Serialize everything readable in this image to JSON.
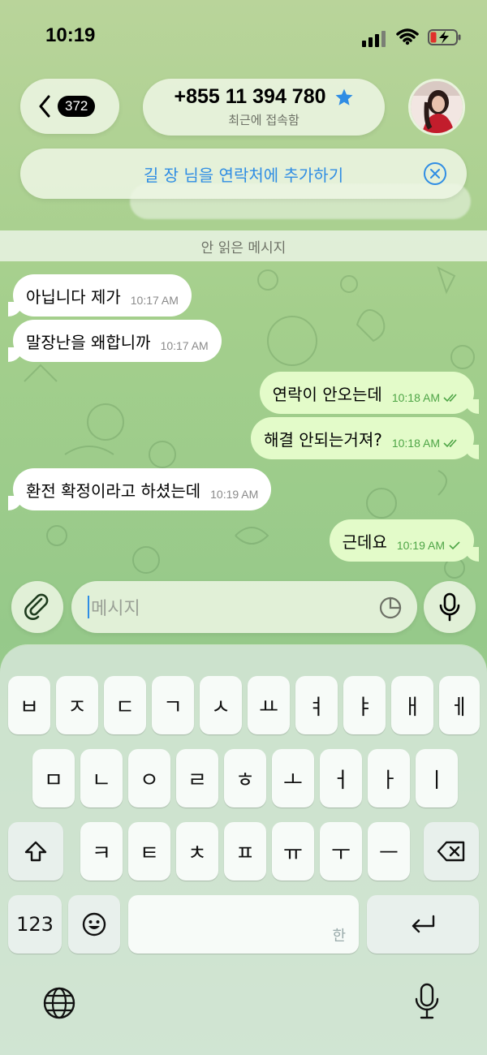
{
  "status_bar": {
    "time": "10:19"
  },
  "header": {
    "unread_count": "372",
    "phone": "+855 11 394 780",
    "subtitle": "최근에 접속함"
  },
  "banner": {
    "text": "길 장 님을 연락처에 추가하기"
  },
  "unread_divider": "안 읽은 메시지",
  "messages": [
    {
      "dir": "in",
      "text": "아닙니다 제가",
      "time": "10:17 AM"
    },
    {
      "dir": "in",
      "text": "말장난을 왜합니까",
      "time": "10:17 AM"
    },
    {
      "dir": "out",
      "text": "연락이 안오는데",
      "time": "10:18 AM",
      "status": "read"
    },
    {
      "dir": "out",
      "text": "해결 안되는거져?",
      "time": "10:18 AM",
      "status": "read"
    },
    {
      "dir": "in",
      "text": "환전 확정이라고 하셨는데",
      "time": "10:19 AM"
    },
    {
      "dir": "out",
      "text": "근데요",
      "time": "10:19 AM",
      "status": "sent"
    }
  ],
  "composer": {
    "placeholder": "메시지"
  },
  "keyboard": {
    "row1": [
      "ㅂ",
      "ㅈ",
      "ㄷ",
      "ㄱ",
      "ㅅ",
      "ㅛ",
      "ㅕ",
      "ㅑ",
      "ㅐ",
      "ㅔ"
    ],
    "row2": [
      "ㅁ",
      "ㄴ",
      "ㅇ",
      "ㄹ",
      "ㅎ",
      "ㅗ",
      "ㅓ",
      "ㅏ",
      "ㅣ"
    ],
    "row3": [
      "ㅋ",
      "ㅌ",
      "ㅊ",
      "ㅍ",
      "ㅠ",
      "ㅜ",
      "ㅡ"
    ],
    "numbers_label": "123",
    "space_hint": "한"
  },
  "colors": {
    "accent": "#2f8de4",
    "outgoing_bubble": "#e3fbc9",
    "read_check": "#4ea546"
  }
}
